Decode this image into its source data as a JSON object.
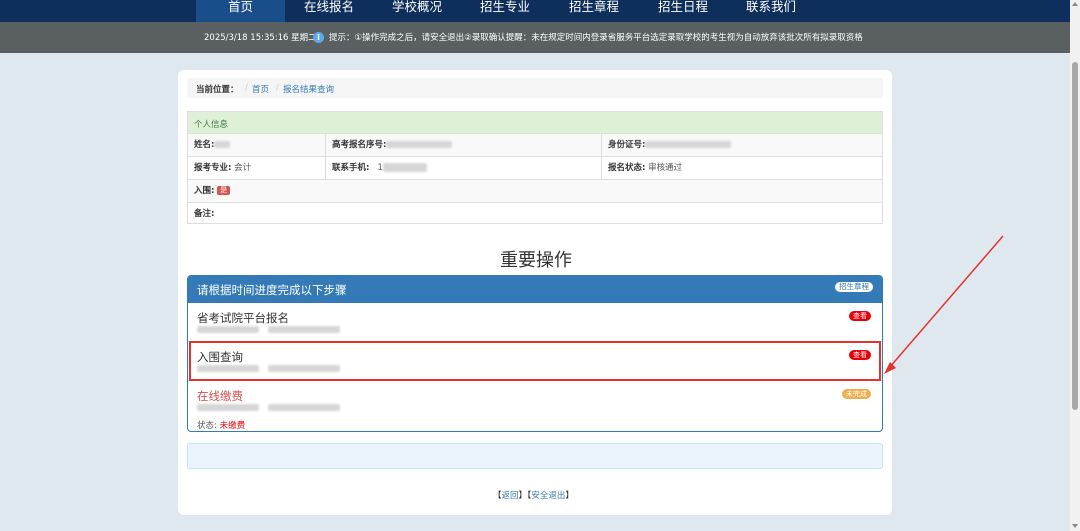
{
  "nav": {
    "items": [
      "首页",
      "在线报名",
      "学校概况",
      "招生专业",
      "招生章程",
      "招生日程",
      "联系我们"
    ]
  },
  "infobar": {
    "datetime": "2025/3/18 15:35:16 星期二",
    "notice": "提示：①操作完成之后，请安全退出②录取确认提醒：未在规定时间内登录省服务平台选定录取学校的考生视为自动放弃该批次所有拟录取资格"
  },
  "breadcrumb": {
    "label": "当前位置：",
    "sep": "/",
    "home": "首页",
    "current": "报名结果查询"
  },
  "personal": {
    "title": "个人信息",
    "name_label": "姓名:",
    "exam_no_label": "高考报名序号:",
    "id_label": "身份证号:",
    "major_label": "报考专业:",
    "major_value": "会计",
    "phone_label": "联系手机:",
    "phone_value": "1",
    "status_label": "报名状态:",
    "status_value": "审核通过",
    "shortlist_label": "入围:",
    "shortlist_badge": "是",
    "remark_label": "备注:"
  },
  "section_title": "重要操作",
  "steps_panel": {
    "title": "请根据时间进度完成以下步骤",
    "header_pill": "招生章程",
    "steps": [
      {
        "name": "省考试院平台报名",
        "badge": "查看"
      },
      {
        "name": "入围查询",
        "badge": "查看"
      },
      {
        "name": "在线缴费",
        "badge": "未完成",
        "status_label": "状态:",
        "status_value": "未缴费"
      }
    ]
  },
  "footer": {
    "back": "返回",
    "logout": "安全退出",
    "left_bracket": "【",
    "right_bracket": "】"
  },
  "colors": {
    "nav_bg": "#0e2f5c",
    "panel_blue": "#337ab7",
    "highlight_red": "#e5322d",
    "badge_red": "#e7000b",
    "badge_orange": "#f0ad4e"
  }
}
